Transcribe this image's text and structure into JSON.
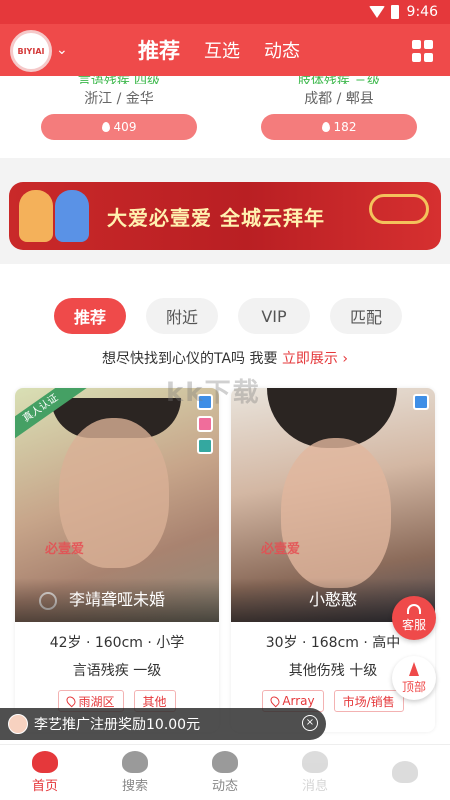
{
  "status_bar": {
    "time": "9:46"
  },
  "header": {
    "logo_text": "BIYIAI",
    "tabs": [
      "推荐",
      "互选",
      "动态"
    ],
    "active_tab": 0
  },
  "prev_cards": [
    {
      "disability": "言语残疾 四级",
      "location": "浙江 / 金华",
      "heat": "409"
    },
    {
      "disability": "肢体残疾 三级",
      "location": "成都 / 郫县",
      "heat": "182"
    }
  ],
  "banner": {
    "text": "大爱必壹爱  全城云拜年"
  },
  "filter_tabs": [
    "推荐",
    "附近",
    "VIP",
    "匹配"
  ],
  "prompt": {
    "text": "想尽快找到心仪的TA吗 我要 ",
    "link": "立即展示 ›"
  },
  "watermark": "kk下载",
  "profiles": [
    {
      "name": "李靖聋哑未婚",
      "verified_label": "真人认证",
      "photo_stamp": "必壹爱",
      "info": "42岁 · 160cm · 小学",
      "disability": "言语残疾 一级",
      "tags": [
        "雨湖区",
        "其他"
      ]
    },
    {
      "name": "小憨憨",
      "photo_stamp": "必壹爱",
      "info": "30岁 · 168cm · 高中",
      "disability": "其他伤残 十级",
      "tags": [
        "Array",
        "市场/销售"
      ]
    }
  ],
  "float_buttons": {
    "service": "客服",
    "top": "顶部"
  },
  "toast": {
    "text": "李艺推广注册奖励10.00元",
    "close": "×"
  },
  "bottom_nav": [
    "首页",
    "搜索",
    "动态",
    "消息"
  ],
  "colors": {
    "brand_red": "#ef4a4a",
    "green": "#3db84c"
  }
}
